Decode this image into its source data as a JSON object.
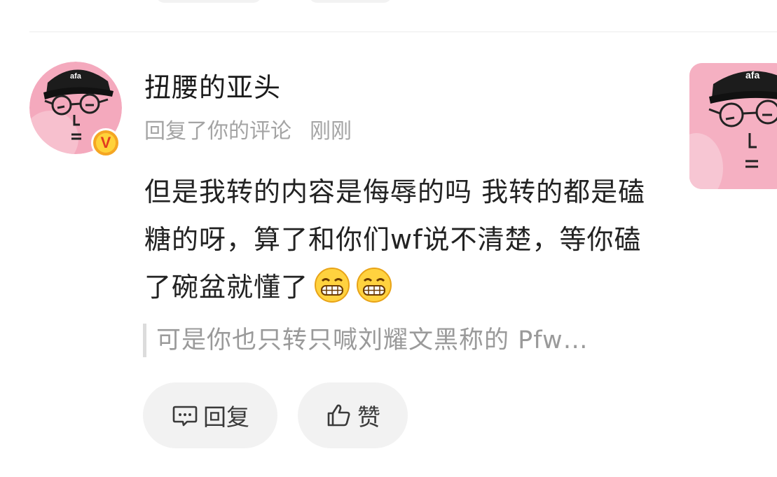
{
  "comment": {
    "username": "扭腰的亚头",
    "action_text": "回复了你的评论",
    "time": "刚刚",
    "content": "但是我转的内容是侮辱的吗 我转的都是磕糖的呀，算了和你们wf说不清楚，等你磕了碗盆就懂了",
    "emojis": [
      "grin-emoji",
      "grin-emoji"
    ],
    "quote": "可是你也只转只喊刘耀文黑称的 Pfw…",
    "verified_badge": "V"
  },
  "actions": {
    "reply_label": "回复",
    "like_label": "赞"
  },
  "avatar_text": "afa",
  "colors": {
    "avatar_bg": "#f4a9bd",
    "cap": "#1c1c1c",
    "badge_outer": "#f5a623",
    "badge_letter": "#e23a1e",
    "button_bg": "#f2f2f2",
    "meta_text": "#a4a4a4"
  }
}
